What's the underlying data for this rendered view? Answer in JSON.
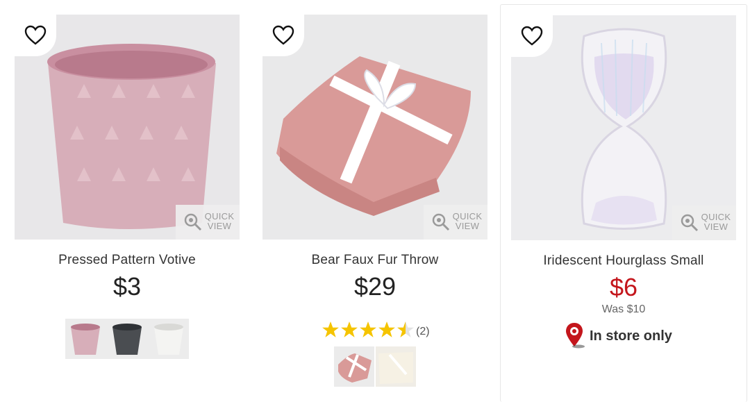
{
  "quick_view_label_1": "QUICK",
  "quick_view_label_2": "VIEW",
  "products": [
    {
      "title": "Pressed Pattern Votive",
      "price": "$3",
      "swatches": [
        "pink",
        "charcoal",
        "white"
      ]
    },
    {
      "title": "Bear Faux Fur Throw",
      "price": "$29",
      "rating": 4.5,
      "review_count": "(2)",
      "thumbnails": [
        "pink-throw",
        "cream-throw"
      ]
    },
    {
      "title": "Iridescent Hourglass Small",
      "price": "$6",
      "was_price": "Was $10",
      "availability": "In store only"
    }
  ],
  "colors": {
    "sale_price": "#c4161c",
    "star": "#f5c400",
    "pin": "#c4161c"
  },
  "icons": [
    "heart-icon",
    "magnifier-icon",
    "location-pin-icon",
    "star-icon"
  ]
}
